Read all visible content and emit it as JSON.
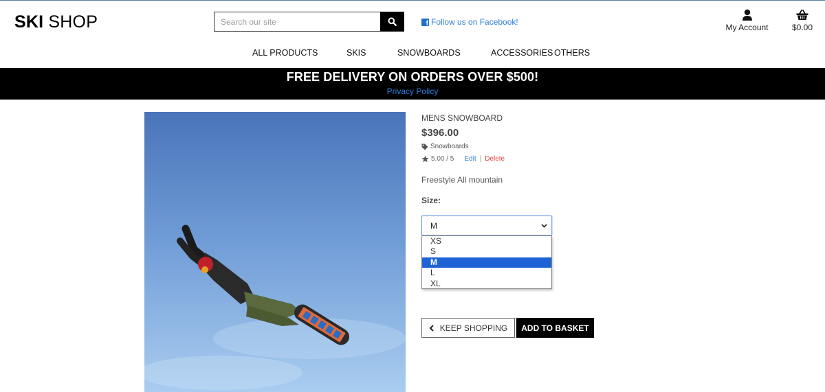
{
  "header": {
    "logo_bold": "SKI",
    "logo_rest": " SHOP",
    "search_placeholder": "Search our site",
    "facebook_label": "Follow us on Facebook!",
    "account_label": "My Account",
    "basket_total": "$0.00"
  },
  "nav": {
    "items": [
      "ALL PRODUCTS",
      "SKIS",
      "SNOWBOARDS",
      "ACCESSORIES",
      "OTHERS"
    ]
  },
  "banner": {
    "promo": "FREE DELIVERY ON ORDERS OVER $500!",
    "privacy": "Privacy Policy"
  },
  "product": {
    "name": "Mens Snowboard",
    "price": "$396.00",
    "category": "Snowboards",
    "rating": "5.00 / 5",
    "edit_label": "Edit",
    "separator": "|",
    "delete_label": "Delete",
    "description": "Freestyle All mountain",
    "size_label": "Size:",
    "selected_size": "M",
    "size_options": [
      "XS",
      "S",
      "M",
      "L",
      "XL"
    ]
  },
  "actions": {
    "keep_shopping": "KEEP SHOPPING",
    "add_to_basket": "ADD TO BASKET"
  },
  "colors": {
    "accent_link": "#2f7fd9",
    "delete": "#e0443f",
    "banner_bg": "#000000",
    "option_highlight": "#1e63d6",
    "sky_top": "#4a74b9",
    "sky_bottom": "#a9cdf0"
  }
}
